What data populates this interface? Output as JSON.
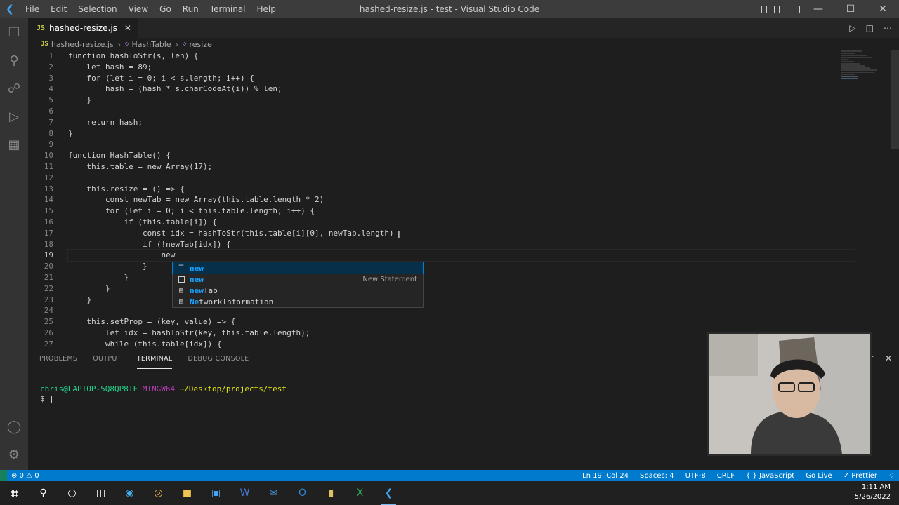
{
  "app": {
    "title": "hashed-resize.js - test - Visual Studio Code",
    "menu": [
      "File",
      "Edit",
      "Selection",
      "View",
      "Go",
      "Run",
      "Terminal",
      "Help"
    ]
  },
  "tabs": [
    {
      "label": "hashed-resize.js",
      "lang": "JS"
    }
  ],
  "breadcrumbs": [
    "hashed-resize.js",
    "HashTable",
    "resize"
  ],
  "code": {
    "line_numbers": [
      "1",
      "2",
      "3",
      "4",
      "5",
      "6",
      "7",
      "8",
      "9",
      "10",
      "11",
      "12",
      "13",
      "14",
      "15",
      "16",
      "17",
      "18",
      "19",
      "20",
      "21",
      "22",
      "23",
      "24",
      "25",
      "26",
      "27"
    ],
    "lines": [
      "function hashToStr(s, len) {",
      "    let hash = 89;",
      "    for (let i = 0; i < s.length; i++) {",
      "        hash = (hash * s.charCodeAt(i)) % len;",
      "    }",
      "",
      "    return hash;",
      "}",
      "",
      "function HashTable() {",
      "    this.table = new Array(17);",
      "",
      "    this.resize = () => {",
      "        const newTab = new Array(this.table.length * 2)",
      "        for (let i = 0; i < this.table.length; i++) {",
      "            if (this.table[i]) {",
      "                const idx = hashToStr(this.table[i][0], newTab.length)",
      "                if (!newTab[idx]) {",
      "                    new",
      "                }",
      "            }",
      "        }",
      "    }",
      "",
      "    this.setProp = (key, value) => {",
      "        let idx = hashToStr(key, this.table.length);",
      "        while (this.table[idx]) {"
    ],
    "active_line": 19
  },
  "suggest": [
    {
      "icon": "keyword-icon",
      "match": "new",
      "rest": "",
      "detail": ""
    },
    {
      "icon": "snippet-icon",
      "match": "new",
      "rest": "",
      "detail": "New Statement"
    },
    {
      "icon": "word-icon",
      "match": "new",
      "rest": "Tab",
      "detail": ""
    },
    {
      "icon": "word-icon",
      "match": "Ne",
      "rest": "tworkInformation",
      "detail": ""
    }
  ],
  "panel": {
    "tabs": [
      "PROBLEMS",
      "OUTPUT",
      "TERMINAL",
      "DEBUG CONSOLE"
    ],
    "active_tab": "TERMINAL",
    "terminal": {
      "user": "chris@LAPTOP-5Q8QP8TF",
      "shell": "MINGW64",
      "path": "~/Desktop/projects/test",
      "prompt": "$"
    }
  },
  "status": {
    "problems": "⊗ 0  ⚠ 0",
    "position": "Ln 19, Col 24",
    "spaces": "Spaces: 4",
    "encoding": "UTF-8",
    "eol": "CRLF",
    "language": "{ } JavaScript",
    "golive": "Go Live",
    "prettier": "✓ Prettier"
  },
  "taskbar": {
    "time": "1:11 AM",
    "date": "5/26/2022"
  }
}
